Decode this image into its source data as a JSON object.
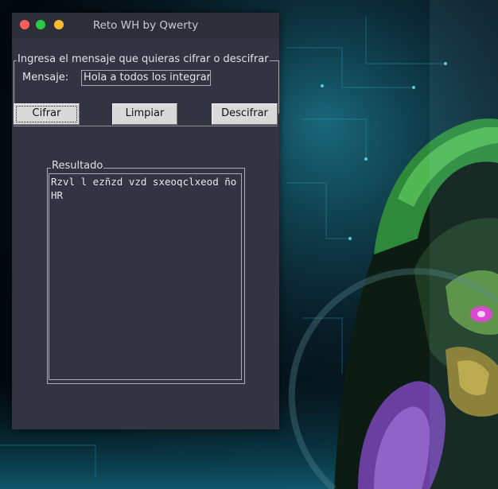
{
  "window": {
    "title": "Reto WH by Qwerty",
    "controls": [
      "close",
      "minimize",
      "maximize"
    ]
  },
  "form": {
    "legend": "Ingresa el mensaje que quieras cifrar o descifrar",
    "message_label": "Mensaje:",
    "message_value": "Hola a todos los integrar"
  },
  "buttons": {
    "encrypt_label": "Cifrar",
    "clear_label": "Limpiar",
    "decrypt_label": "Descifrar"
  },
  "result": {
    "legend": "Resultado",
    "text": "Rzvl l ezñzd vzd sxeoqclxeod ño HR"
  },
  "colors": {
    "close": "#ff5f57",
    "minimize": "#28ca41",
    "maximize": "#fbbd2f",
    "window_bg": "#323441",
    "button_bg": "#d9d9d9"
  }
}
